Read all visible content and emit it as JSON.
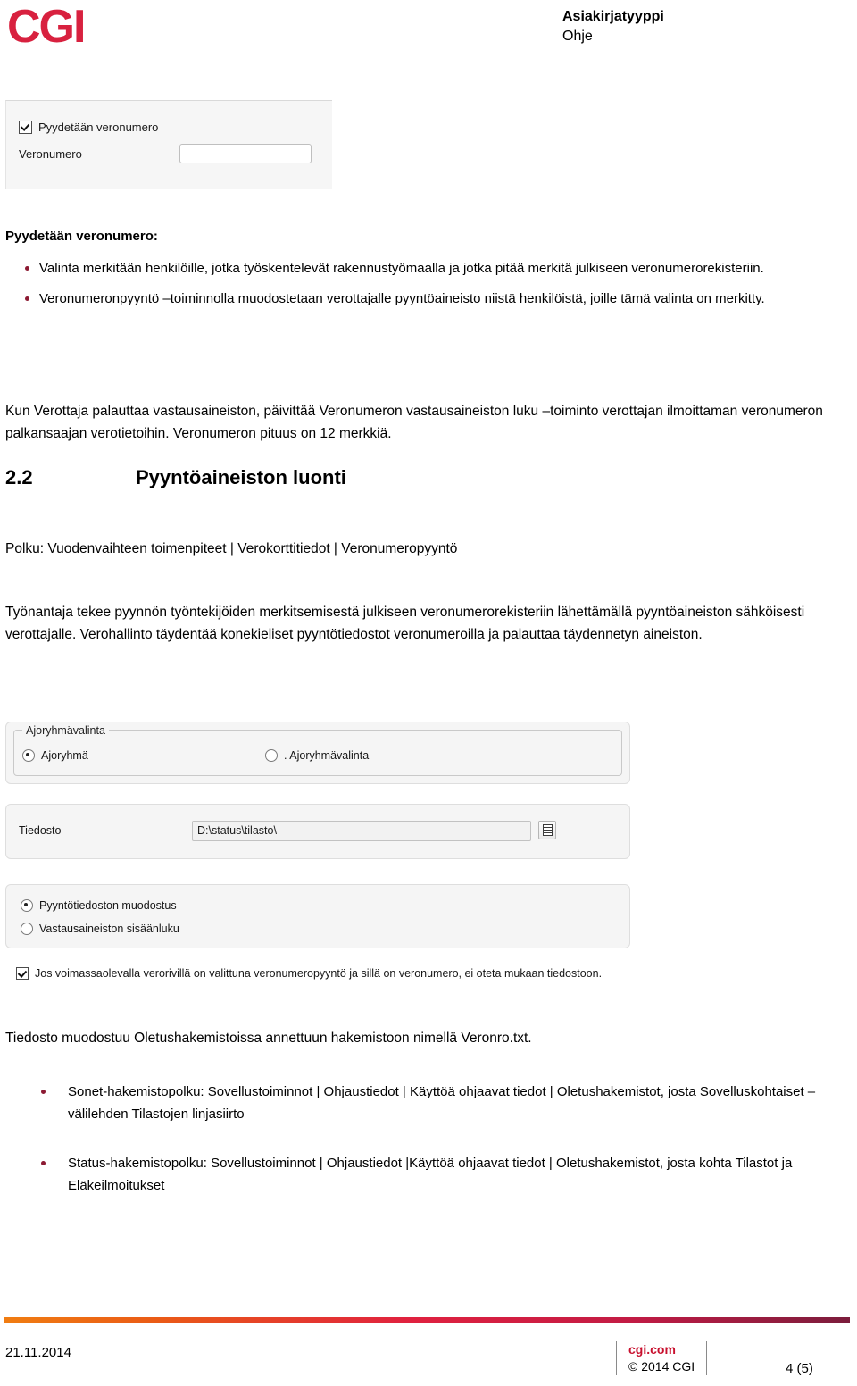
{
  "header": {
    "logo_text": "CGI",
    "logo_color": "#D8213F",
    "doc_type": "Asiakirjatyyppi",
    "doc_subtype": "Ohje"
  },
  "screenshot_1": {
    "checkbox_label": "Pyydetään veronumero",
    "checkbox_checked": true,
    "field_label": "Veronumero",
    "field_value": ""
  },
  "section_1": {
    "heading": "Pyydetään veronumero:",
    "bullets": [
      "Valinta merkitään henkilöille, jotka työskentelevät rakennustyömaalla ja jotka pitää merkitä julkiseen veronumerorekisteriin.",
      "Veronumeronpyyntö –toiminnolla muodostetaan verottajalle  pyyntöaineisto niistä henkilöistä, joille tämä valinta on merkitty."
    ],
    "paragraph": "Kun Verottaja palauttaa vastausaineiston, päivittää Veronumeron vastausaineiston luku –toiminto verottajan ilmoittaman veronumeron palkansaajan verotietoihin. Veronumeron pituus on 12 merkkiä."
  },
  "section_2": {
    "number": "2.2",
    "title": "Pyyntöaineiston luonti",
    "path_line": "Polku: Vuodenvaihteen toimenpiteet | Verokorttitiedot | Veronumeropyyntö",
    "paragraph": "Työnantaja tekee pyynnön työntekijöiden merkitsemisestä julkiseen veronumerorekisteriin lähettämällä pyyntöaineiston sähköisesti verottajalle. Verohallinto täydentää konekieliset pyyntötiedostot veronumeroilla ja palauttaa täydennetyn aineiston."
  },
  "screenshot_2": {
    "groupbox_title": "Ajoryhmävalinta",
    "radio_ajoryhma": "Ajoryhmä",
    "radio_ajoryhmavalinta": ". Ajoryhmävalinta",
    "file_label": "Tiedosto",
    "file_value": "D:\\status\\tilasto\\",
    "browse_icon": "list-icon",
    "radio_pyyntotiedosto": "Pyyntötiedoston muodostus",
    "radio_vastausaineisto": "Vastausaineiston sisäänluku",
    "note_checkbox_label": "Jos voimassaolevalla verorivillä on valittuna veronumeropyyntö ja sillä on veronumero, ei oteta mukaan tiedostoon.",
    "note_checked": true
  },
  "section_3": {
    "paragraph": "Tiedosto muodostuu Oletushakemistoissa annettuun hakemistoon nimellä Veronro.txt.",
    "bullets": [
      "Sonet-hakemistopolku: Sovellustoiminnot | Ohjaustiedot | Käyttöä ohjaavat tiedot | Oletushakemistot, josta Sovelluskohtaiset –välilehden Tilastojen linjasiirto",
      "Status-hakemistopolku: Sovellustoiminnot | Ohjaustiedot |Käyttöä ohjaavat tiedot | Oletushakemistot, josta kohta Tilastot ja Eläkeilmoitukset"
    ]
  },
  "footer": {
    "date": "21.11.2014",
    "url": "cgi.com",
    "copyright": "© 2014 CGI",
    "page": "4 (5)",
    "bar_gradient_start": "#F07D12",
    "bar_gradient_mid": "#E0213F",
    "bar_gradient_end": "#7B1C3C"
  }
}
